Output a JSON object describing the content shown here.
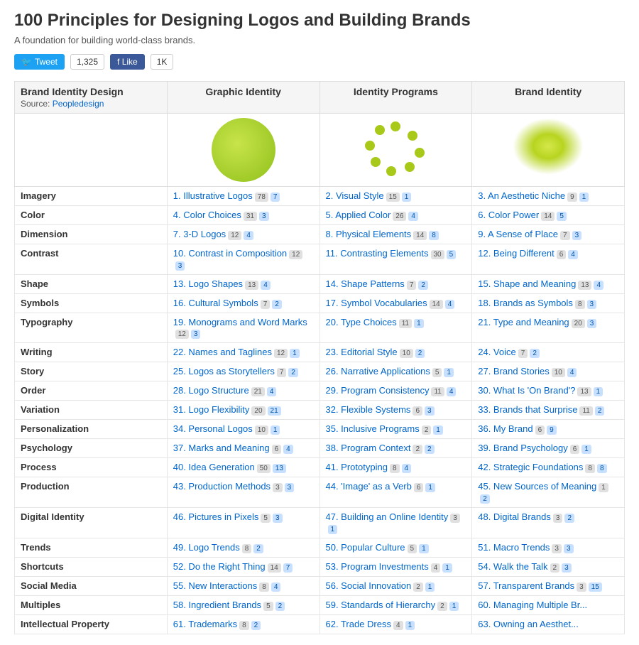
{
  "page": {
    "title": "100 Principles for Designing Logos and Building Brands",
    "subtitle": "A foundation for building world-class brands.",
    "social": {
      "tweet_label": "Tweet",
      "tweet_count": "1,325",
      "like_label": "Like",
      "like_count": "1K"
    }
  },
  "columns": {
    "col1": "Brand Identity Design",
    "col1_source": "Source:",
    "col1_source_link": "Peopledesign",
    "col2": "Graphic Identity",
    "col3": "Identity Programs",
    "col4": "Brand Identity"
  },
  "rows": [
    {
      "category": "Imagery",
      "c2": "1. Illustrative Logos",
      "c2_b1": "78",
      "c2_b2": "7",
      "c3": "2. Visual Style",
      "c3_b1": "15",
      "c3_b2": "1",
      "c4": "3. An Aesthetic Niche",
      "c4_b1": "9",
      "c4_b2": "1"
    },
    {
      "category": "Color",
      "c2": "4. Color Choices",
      "c2_b1": "31",
      "c2_b2": "3",
      "c3": "5. Applied Color",
      "c3_b1": "26",
      "c3_b2": "4",
      "c4": "6. Color Power",
      "c4_b1": "14",
      "c4_b2": "5"
    },
    {
      "category": "Dimension",
      "c2": "7. 3-D Logos",
      "c2_b1": "12",
      "c2_b2": "4",
      "c3": "8. Physical Elements",
      "c3_b1": "14",
      "c3_b2": "8",
      "c4": "9. A Sense of Place",
      "c4_b1": "7",
      "c4_b2": "3"
    },
    {
      "category": "Contrast",
      "c2": "10. Contrast in Composition",
      "c2_b1": "12",
      "c2_b2": "3",
      "c3": "11. Contrasting Elements",
      "c3_b1": "30",
      "c3_b2": "5",
      "c4": "12. Being Different",
      "c4_b1": "6",
      "c4_b2": "4"
    },
    {
      "category": "Shape",
      "c2": "13. Logo Shapes",
      "c2_b1": "13",
      "c2_b2": "4",
      "c3": "14. Shape Patterns",
      "c3_b1": "7",
      "c3_b2": "2",
      "c4": "15. Shape and Meaning",
      "c4_b1": "13",
      "c4_b2": "4"
    },
    {
      "category": "Symbols",
      "c2": "16. Cultural Symbols",
      "c2_b1": "7",
      "c2_b2": "2",
      "c3": "17. Symbol Vocabularies",
      "c3_b1": "14",
      "c3_b2": "4",
      "c4": "18. Brands as Symbols",
      "c4_b1": "8",
      "c4_b2": "3"
    },
    {
      "category": "Typography",
      "c2": "19. Monograms and Word Marks",
      "c2_b1": "12",
      "c2_b2": "3",
      "c3": "20. Type Choices",
      "c3_b1": "11",
      "c3_b2": "1",
      "c4": "21. Type and Meaning",
      "c4_b1": "20",
      "c4_b2": "3"
    },
    {
      "category": "Writing",
      "c2": "22. Names and Taglines",
      "c2_b1": "12",
      "c2_b2": "1",
      "c3": "23. Editorial Style",
      "c3_b1": "10",
      "c3_b2": "2",
      "c4": "24. Voice",
      "c4_b1": "7",
      "c4_b2": "2"
    },
    {
      "category": "Story",
      "c2": "25. Logos as Storytellers",
      "c2_b1": "7",
      "c2_b2": "2",
      "c3": "26. Narrative Applications",
      "c3_b1": "5",
      "c3_b2": "1",
      "c4": "27. Brand Stories",
      "c4_b1": "10",
      "c4_b2": "4"
    },
    {
      "category": "Order",
      "c2": "28. Logo Structure",
      "c2_b1": "21",
      "c2_b2": "4",
      "c3": "29. Program Consistency",
      "c3_b1": "11",
      "c3_b2": "4",
      "c4": "30. What Is 'On Brand'?",
      "c4_b1": "13",
      "c4_b2": "1"
    },
    {
      "category": "Variation",
      "c2": "31. Logo Flexibility",
      "c2_b1": "20",
      "c2_b2": "21",
      "c3": "32. Flexible Systems",
      "c3_b1": "6",
      "c3_b2": "3",
      "c4": "33. Brands that Surprise",
      "c4_b1": "11",
      "c4_b2": "2"
    },
    {
      "category": "Personalization",
      "c2": "34. Personal Logos",
      "c2_b1": "10",
      "c2_b2": "1",
      "c3": "35. Inclusive Programs",
      "c3_b1": "2",
      "c3_b2": "1",
      "c4": "36. My Brand",
      "c4_b1": "6",
      "c4_b2": "9"
    },
    {
      "category": "Psychology",
      "c2": "37. Marks and Meaning",
      "c2_b1": "6",
      "c2_b2": "4",
      "c3": "38. Program Context",
      "c3_b1": "2",
      "c3_b2": "2",
      "c4": "39. Brand Psychology",
      "c4_b1": "6",
      "c4_b2": "1"
    },
    {
      "category": "Process",
      "c2": "40. Idea Generation",
      "c2_b1": "50",
      "c2_b2": "13",
      "c3": "41. Prototyping",
      "c3_b1": "8",
      "c3_b2": "4",
      "c4": "42. Strategic Foundations",
      "c4_b1": "8",
      "c4_b2": "8"
    },
    {
      "category": "Production",
      "c2": "43. Production Methods",
      "c2_b1": "3",
      "c2_b2": "3",
      "c3": "44. 'Image' as a Verb",
      "c3_b1": "6",
      "c3_b2": "1",
      "c4": "45. New Sources of Meaning",
      "c4_b1": "1",
      "c4_b2": "2"
    },
    {
      "category": "Digital Identity",
      "c2": "46. Pictures in Pixels",
      "c2_b1": "5",
      "c2_b2": "3",
      "c3": "47. Building an Online Identity",
      "c3_b1": "3",
      "c3_b2": "1",
      "c4": "48. Digital Brands",
      "c4_b1": "3",
      "c4_b2": "2"
    },
    {
      "category": "Trends",
      "c2": "49. Logo Trends",
      "c2_b1": "8",
      "c2_b2": "2",
      "c3": "50. Popular Culture",
      "c3_b1": "5",
      "c3_b2": "1",
      "c4": "51. Macro Trends",
      "c4_b1": "3",
      "c4_b2": "3"
    },
    {
      "category": "Shortcuts",
      "c2": "52. Do the Right Thing",
      "c2_b1": "14",
      "c2_b2": "7",
      "c3": "53. Program Investments",
      "c3_b1": "4",
      "c3_b2": "1",
      "c4": "54. Walk the Talk",
      "c4_b1": "2",
      "c4_b2": "3"
    },
    {
      "category": "Social Media",
      "c2": "55. New Interactions",
      "c2_b1": "8",
      "c2_b2": "4",
      "c3": "56. Social Innovation",
      "c3_b1": "2",
      "c3_b2": "1",
      "c4": "57. Transparent Brands",
      "c4_b1": "3",
      "c4_b2": "15"
    },
    {
      "category": "Multiples",
      "c2": "58. Ingredient Brands",
      "c2_b1": "5",
      "c2_b2": "2",
      "c3": "59. Standards of Hierarchy",
      "c3_b1": "2",
      "c3_b2": "1",
      "c4": "60. Managing Multiple Br...",
      "c4_b1": "",
      "c4_b2": ""
    },
    {
      "category": "Intellectual Property",
      "c2": "61. Trademarks",
      "c2_b1": "8",
      "c2_b2": "2",
      "c3": "62. Trade Dress",
      "c3_b1": "4",
      "c3_b2": "1",
      "c4": "63. Owning an Aesthet...",
      "c4_b1": "",
      "c4_b2": ""
    }
  ]
}
